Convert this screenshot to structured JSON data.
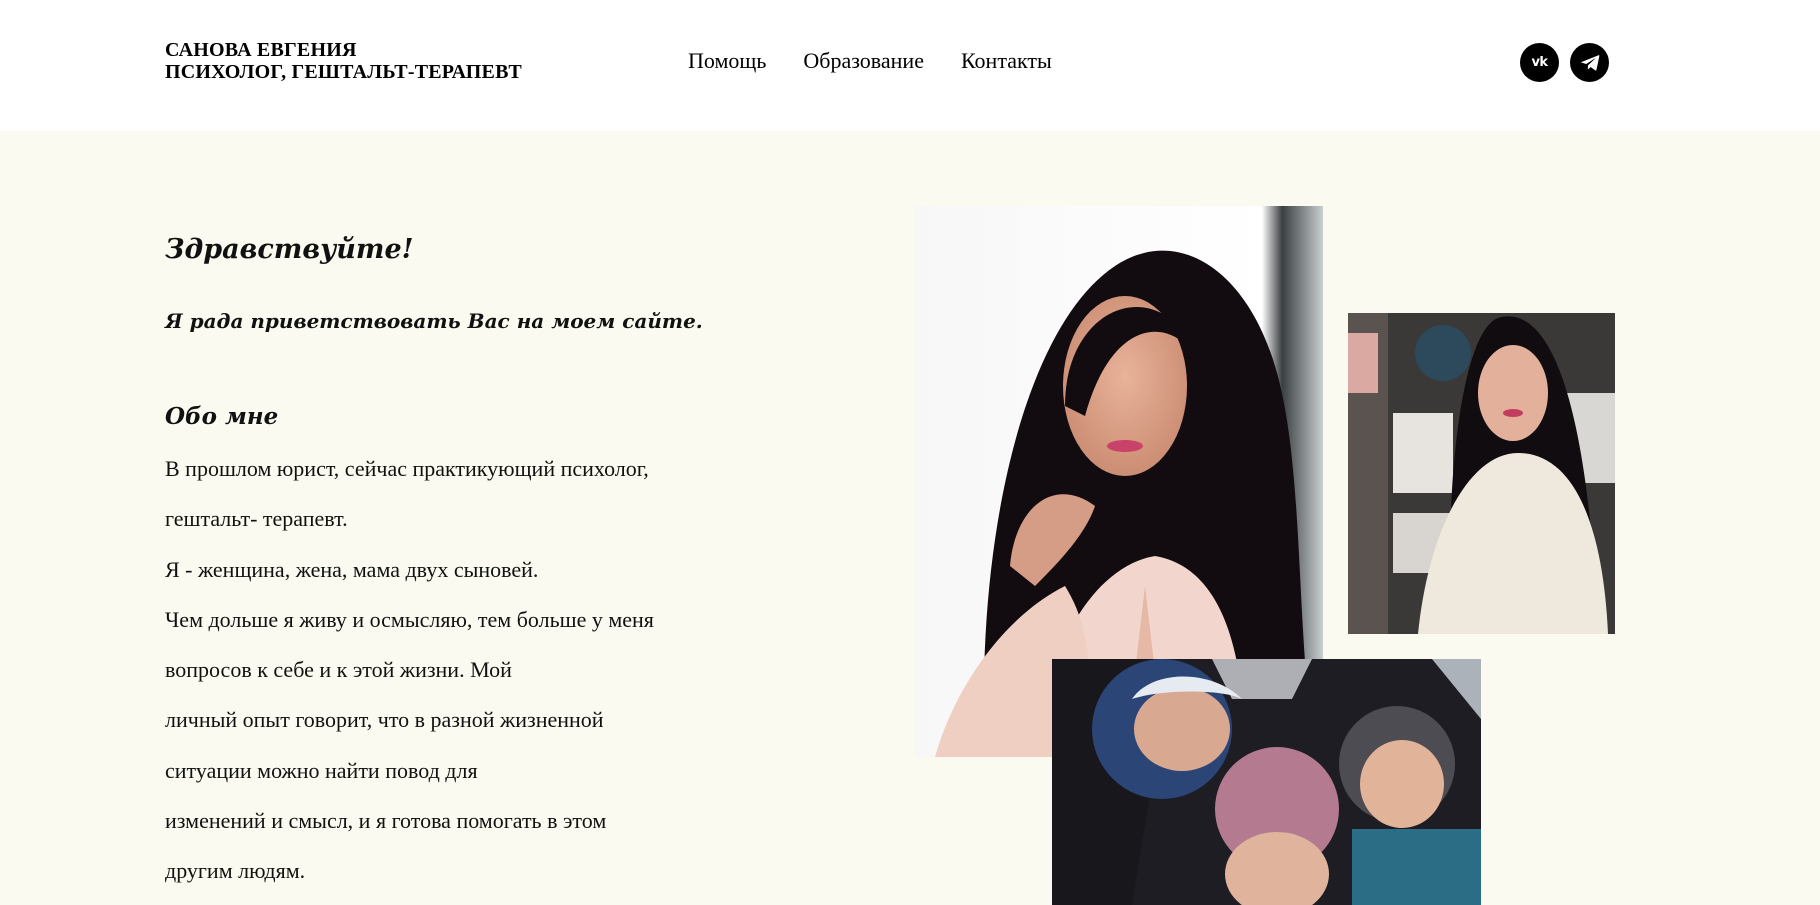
{
  "header": {
    "brand_line1": "САНОВА ЕВГЕНИЯ",
    "brand_line2": "ПСИХОЛОГ, ГЕШТАЛЬТ-ТЕРАПЕВТ",
    "nav": [
      {
        "label": "Помощь"
      },
      {
        "label": "Образование"
      },
      {
        "label": "Контакты"
      }
    ],
    "social": [
      {
        "icon": "vk-icon",
        "glyph": "vk"
      },
      {
        "icon": "telegram-icon",
        "glyph": ""
      }
    ]
  },
  "main": {
    "greeting": "Здравствуйте!",
    "welcome": "Я рада приветствовать Вас на моем сайте.",
    "about_title": "Обо мне",
    "about_lines": [
      "В прошлом юрист, сейчас практикующий психолог,",
      "гештальт- терапевт.",
      "Я - женщина, жена, мама двух сыновей.",
      "Чем дольше я живу и осмысляю, тем больше у меня",
      "вопросов к себе и к этой жизни. Мой",
      "личный опыт говорит, что в разной жизненной",
      "ситуации можно найти повод для",
      "изменений и смысл, и я готова помогать в этом",
      "другим людям."
    ]
  },
  "colors": {
    "page_bg": "#fafaf0",
    "header_bg": "#ffffff",
    "text": "#111111",
    "social_bg": "#000000"
  }
}
